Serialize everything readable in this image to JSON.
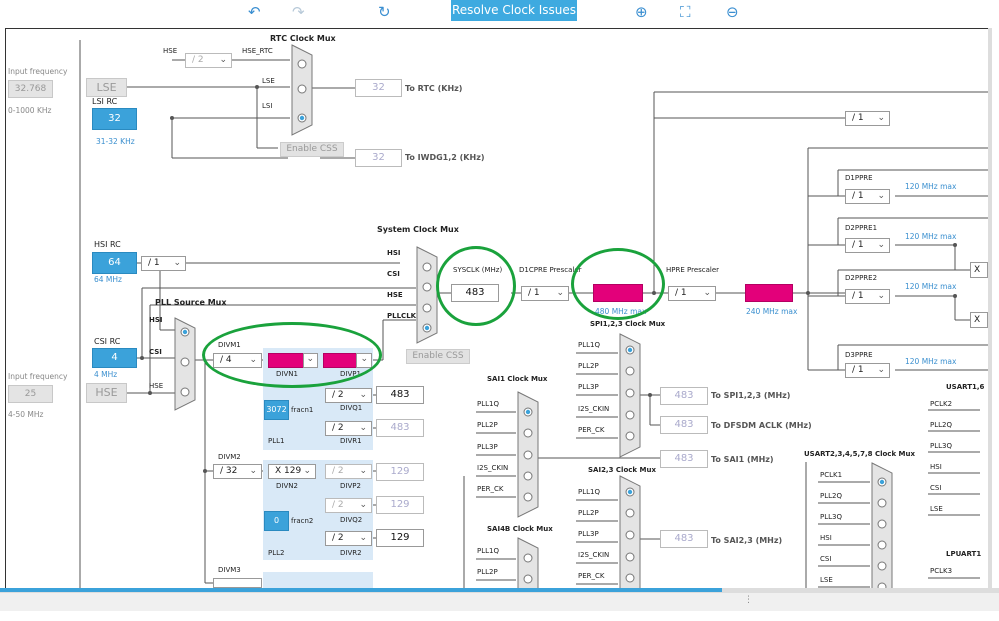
{
  "toolbar": {
    "undo_icon": "undo-icon",
    "redo_icon": "redo-icon",
    "refresh_icon": "refresh-icon",
    "resolve_label": "Resolve Clock Issues",
    "zoom_in_icon": "zoom-in-icon",
    "fit_icon": "fit-icon",
    "zoom_out_icon": "zoom-out-icon"
  },
  "colors": {
    "accent": "#3eaae0",
    "error": "#e3007a",
    "highlight": "#1aa23c"
  },
  "lse": {
    "input_label": "Input frequency",
    "input_value": "32.768",
    "range": "0-1000 KHz",
    "name": "LSE"
  },
  "lsirc": {
    "label": "LSI RC",
    "value": "32",
    "range": "31-32 KHz"
  },
  "rtc": {
    "mux_title": "RTC Clock Mux",
    "hse_label": "HSE",
    "hse_div": "/ 2",
    "hse_rtc": "HSE_RTC",
    "lse_label": "LSE",
    "lsi_label": "LSI",
    "out_value": "32",
    "out_label": "To RTC (KHz)",
    "enable_css": "Enable CSS",
    "iwdg_value": "32",
    "iwdg_label": "To IWDG1,2 (KHz)"
  },
  "hsirc": {
    "label": "HSI RC",
    "value": "64",
    "freq": "64 MHz",
    "div": "/ 1"
  },
  "csirc": {
    "label": "CSI RC",
    "value": "4",
    "freq": "4 MHz"
  },
  "hse": {
    "input_label": "Input frequency",
    "input_value": "25",
    "range": "4-50 MHz",
    "name": "HSE"
  },
  "pll_source": {
    "title": "PLL Source Mux",
    "hsi": "HSI",
    "csi": "CSI",
    "hse": "HSE"
  },
  "sysmux": {
    "title": "System Clock Mux",
    "hsi": "HSI",
    "csi": "CSI",
    "hse": "HSE",
    "pllclk": "PLLCLK",
    "enable_css": "Enable CSS"
  },
  "sysclk": {
    "label": "SYSCLK (MHz)",
    "value": "483"
  },
  "d1cpre": {
    "label": "D1CPRE Prescaler",
    "div": "/ 1",
    "max": "480 MHz max"
  },
  "hpre": {
    "label": "HPRE Prescaler",
    "div": "/ 1",
    "max": "240 MHz max"
  },
  "pll1": {
    "divm_label": "DIVM1",
    "divm": "/ 4",
    "divn_label": "DIVN1",
    "divp_label": "DIVP1",
    "fracn": "3072",
    "fracn_label": "fracn1",
    "divq": "/ 2",
    "divq_label": "DIVQ1",
    "divr": "/ 2",
    "divr_label": "DIVR1",
    "p_out": "483",
    "r_out": "483",
    "name": "PLL1"
  },
  "pll2": {
    "divm_label": "DIVM2",
    "divm": "/ 32",
    "divn": "X 129",
    "divn_label": "DIVN2",
    "divp": "/ 2",
    "divp_label": "DIVP2",
    "p_out": "129",
    "fracn": "0",
    "fracn_label": "fracn2",
    "divq": "/ 2",
    "divq_label": "DIVQ2",
    "q_out": "129",
    "divr": "/ 2",
    "divr_label": "DIVR2",
    "r_out": "129",
    "name": "PLL2"
  },
  "pll3": {
    "divm_label": "DIVM3"
  },
  "sai1": {
    "title": "SAI1 Clock Mux",
    "inputs": [
      "PLL1Q",
      "PLL2P",
      "PLL3P",
      "I2S_CKIN",
      "PER_CK"
    ],
    "out_value": "483",
    "out_label": "To SAI1 (MHz)"
  },
  "spi123": {
    "title": "SPI1,2,3 Clock Mux",
    "inputs": [
      "PLL1Q",
      "PLL2P",
      "PLL3P",
      "I2S_CKIN",
      "PER_CK"
    ],
    "out_value": "483",
    "out_label": "To SPI1,2,3 (MHz)",
    "dfsdm_value": "483",
    "dfsdm_label": "To DFSDM ACLK (MHz)"
  },
  "sai23": {
    "title": "SAI2,3 Clock Mux",
    "inputs": [
      "PLL1Q",
      "PLL2P",
      "PLL3P",
      "I2S_CKIN",
      "PER_CK"
    ],
    "out_value": "483",
    "out_label": "To SAI2,3 (MHz)"
  },
  "sai4b": {
    "title": "SAI4B Clock Mux",
    "inputs": [
      "PLL1Q",
      "PLL2P"
    ]
  },
  "right": {
    "top_div": "/ 1",
    "d1ppre": "D1PPRE",
    "d1ppre_div": "/ 1",
    "d1ppre_max": "120 MHz max",
    "d2ppre1": "D2PPRE1",
    "d2ppre1_div": "/ 1",
    "d2ppre1_max": "120 MHz max",
    "d2ppre2": "D2PPRE2",
    "d2ppre2_div": "/ 1",
    "d2ppre2_max": "120 MHz max",
    "d3ppre": "D3PPRE",
    "d3ppre_div": "/ 1",
    "d3ppre_max": "120 MHz max",
    "x1": "X",
    "x2": "X"
  },
  "usart1": {
    "title": "USART1,6",
    "inputs": [
      "PCLK2",
      "PLL2Q",
      "PLL3Q",
      "HSI",
      "CSI",
      "LSE"
    ]
  },
  "usart2": {
    "title": "USART2,3,4,5,7,8 Clock Mux",
    "inputs": [
      "PCLK1",
      "PLL2Q",
      "PLL3Q",
      "HSI",
      "CSI",
      "LSE"
    ]
  },
  "lpuart1": {
    "title": "LPUART1",
    "inputs": [
      "PCLK3"
    ]
  }
}
